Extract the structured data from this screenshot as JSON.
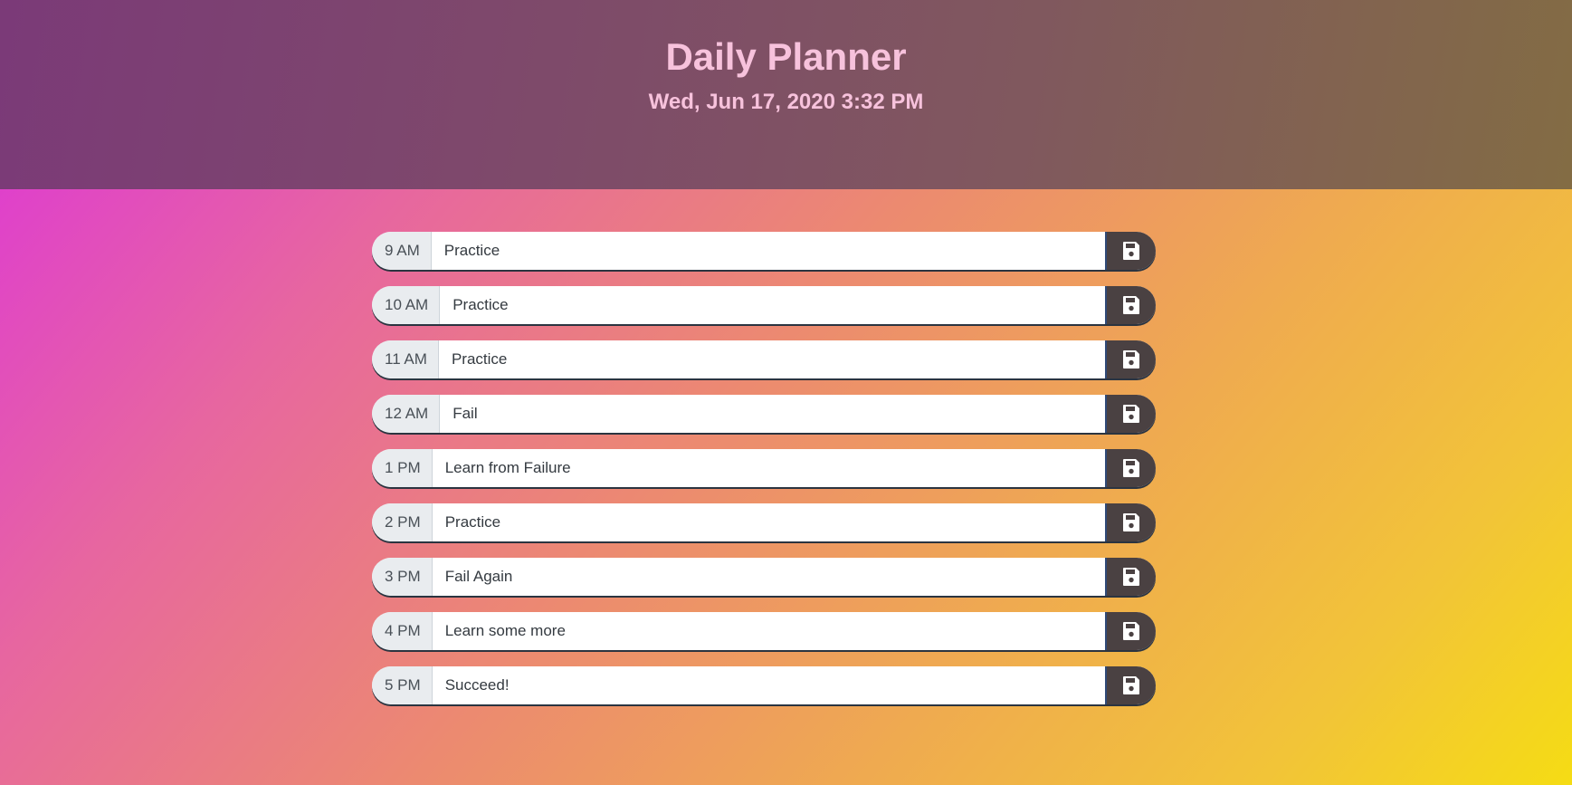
{
  "header": {
    "title": "Daily Planner",
    "datetime": "Wed, Jun 17, 2020 3:32 PM"
  },
  "rows": [
    {
      "hour": "9 AM",
      "task": "Practice",
      "save_icon": "floppy-disk-icon"
    },
    {
      "hour": "10 AM",
      "task": "Practice",
      "save_icon": "floppy-disk-icon"
    },
    {
      "hour": "11 AM",
      "task": "Practice",
      "save_icon": "floppy-disk-icon"
    },
    {
      "hour": "12 AM",
      "task": "Fail",
      "save_icon": "floppy-disk-icon"
    },
    {
      "hour": "1 PM",
      "task": "Learn from Failure",
      "save_icon": "floppy-disk-icon"
    },
    {
      "hour": "2 PM",
      "task": "Practice",
      "save_icon": "floppy-disk-icon"
    },
    {
      "hour": "3 PM",
      "task": "Fail Again",
      "save_icon": "floppy-disk-icon"
    },
    {
      "hour": "4 PM",
      "task": "Learn some more",
      "save_icon": "floppy-disk-icon"
    },
    {
      "hour": "5 PM",
      "task": "Succeed!",
      "save_icon": "floppy-disk-icon"
    }
  ],
  "colors": {
    "header_text": "#f7c2dc",
    "save_button": "#4a4142",
    "hour_label_bg": "#e9ecef"
  }
}
